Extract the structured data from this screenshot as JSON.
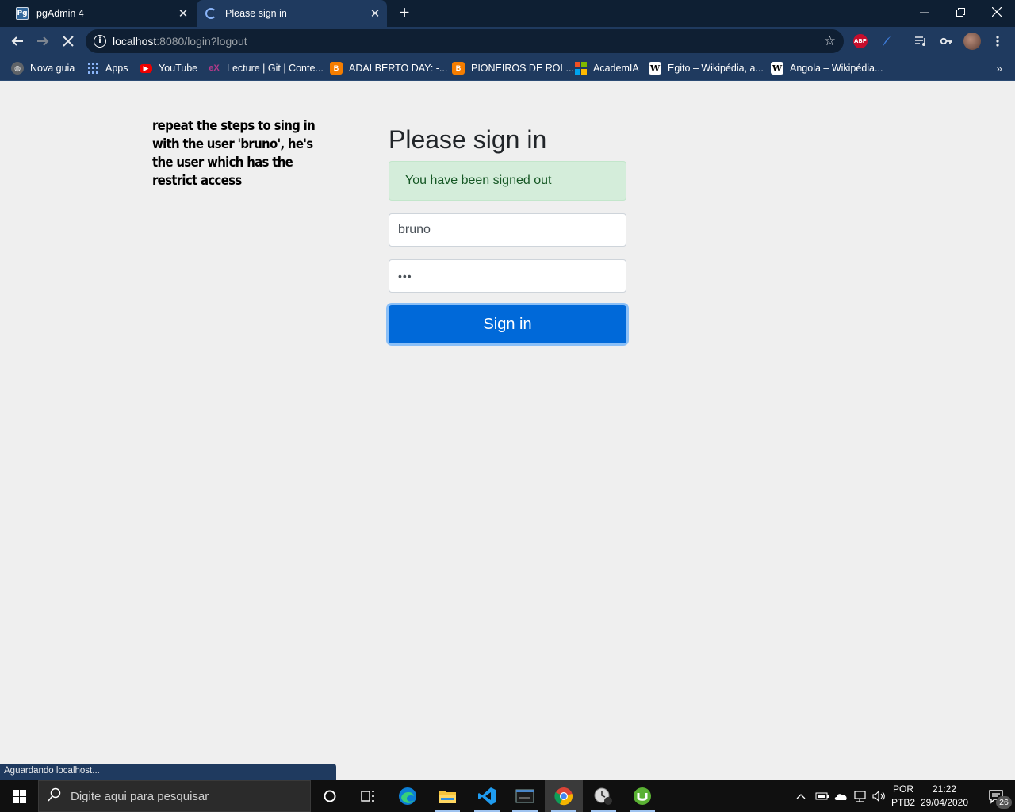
{
  "browser": {
    "tabs": [
      {
        "title": "pgAdmin 4",
        "favicon": "pgadmin-icon",
        "active": false
      },
      {
        "title": "Please sign in",
        "favicon": "loading-spinner-icon",
        "active": true
      }
    ],
    "address": {
      "host": "localhost",
      "path": ":8080/login?logout"
    },
    "extensions": {
      "abp_label": "ABP"
    },
    "bookmarks": [
      {
        "label": "Nova guia",
        "icon": "globe-icon"
      },
      {
        "label": "Apps",
        "icon": "apps-grid-icon"
      },
      {
        "label": "YouTube",
        "icon": "youtube-icon"
      },
      {
        "label": "Lecture | Git | Conte...",
        "icon": "edx-icon"
      },
      {
        "label": "ADALBERTO DAY: -...",
        "icon": "blogger-icon"
      },
      {
        "label": "PIONEIROS DE ROL...",
        "icon": "blogger-icon"
      },
      {
        "label": "AcademIA",
        "icon": "microsoft-icon"
      },
      {
        "label": "Egito – Wikipédia, a...",
        "icon": "wikipedia-icon"
      },
      {
        "label": "Angola – Wikipédia...",
        "icon": "wikipedia-icon"
      }
    ],
    "status_text": "Aguardando localhost..."
  },
  "page": {
    "note": "repeat the steps to sing in with the user 'bruno', he's the user which has the restrict access",
    "heading": "Please sign in",
    "alert": "You have been signed out",
    "username_value": "bruno",
    "password_mask": "•••",
    "signin_label": "Sign in"
  },
  "taskbar": {
    "search_placeholder": "Digite aqui para pesquisar",
    "language_top": "POR",
    "language_bottom": "PTB2",
    "time": "21:22",
    "date": "29/04/2020",
    "notification_count": "26"
  },
  "colors": {
    "tabstrip": "#0e1f33",
    "toolbar": "#1f3a5f",
    "page_bg": "#efefef",
    "alert_bg": "#d4edda",
    "alert_text": "#155724",
    "primary_button": "#0069d9"
  }
}
